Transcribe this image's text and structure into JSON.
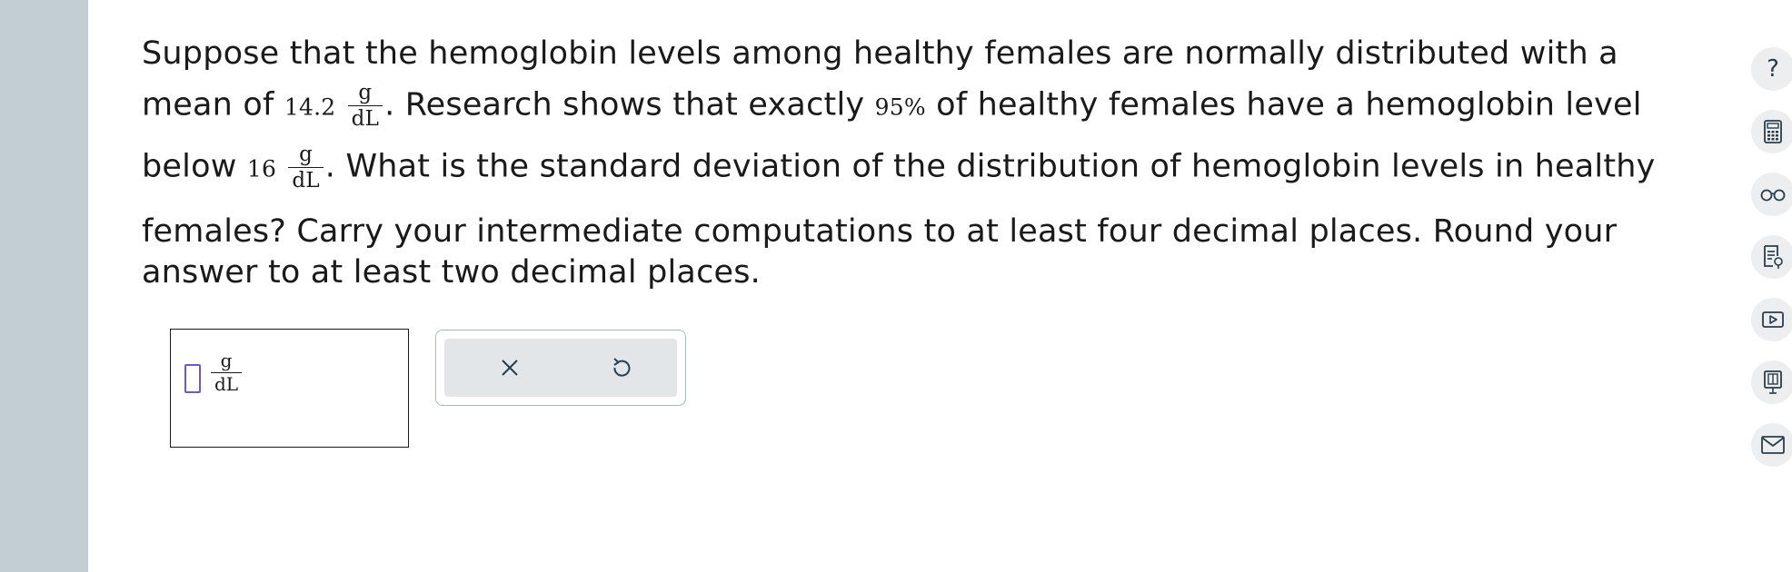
{
  "question": {
    "line1": "Suppose that the hemoglobin levels among healthy females are normally distributed with a",
    "line2_a": "mean of",
    "mean_value": "14.2",
    "line2_b": ". Research shows that exactly",
    "percent_value": "95%",
    "line2_c": "of healthy females have a hemoglobin level",
    "line3_a": "below",
    "threshold_value": "16",
    "line3_b": ". What is the standard deviation of the distribution of hemoglobin levels in healthy",
    "line4": "females? Carry your intermediate computations to at least four decimal places. Round your",
    "line5": "answer to at least two decimal places.",
    "unit_numerator": "g",
    "unit_denominator": "dL"
  },
  "answer": {
    "value": "",
    "unit_numerator": "g",
    "unit_denominator": "dL"
  },
  "tools": {
    "clear_icon": "close-icon",
    "reset_icon": "undo-icon"
  },
  "sidebar": {
    "items": [
      {
        "icon": "help-icon",
        "label": "?"
      },
      {
        "icon": "calculator-icon"
      },
      {
        "icon": "glasses-icon"
      },
      {
        "icon": "notes-icon"
      },
      {
        "icon": "video-icon"
      },
      {
        "icon": "textbook-icon"
      },
      {
        "icon": "mail-icon"
      }
    ]
  },
  "colors": {
    "left_rail": "#c3ced4",
    "cursor": "#6a5acd",
    "tool_border": "#a7b8c2",
    "tool_bg": "#e2e6e9",
    "icon": "#2a3d4a"
  }
}
